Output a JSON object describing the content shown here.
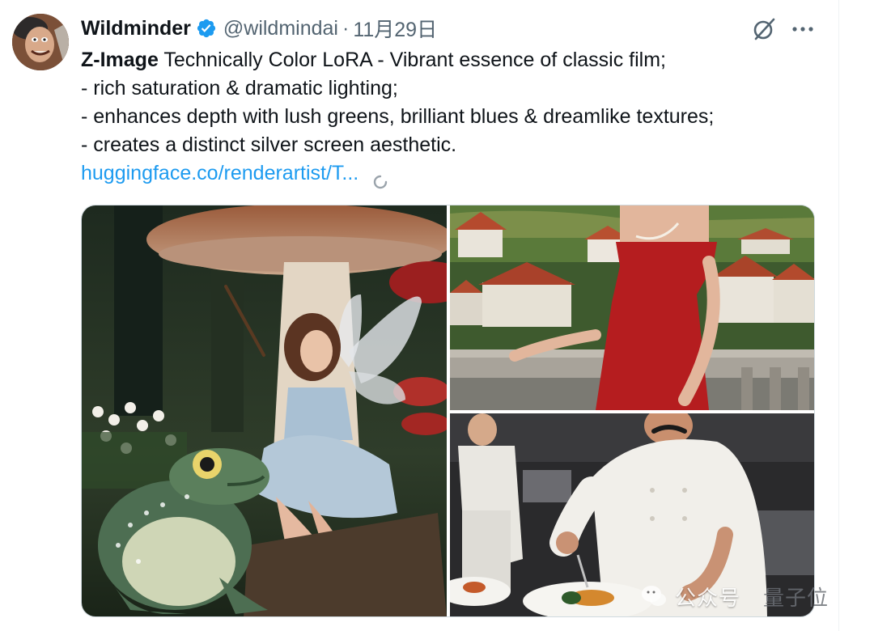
{
  "tweet": {
    "author": {
      "display_name": "Wildminder",
      "handle": "@wildmindai",
      "verified": true,
      "avatar": "avatar-portrait"
    },
    "separator": "·",
    "timestamp": "11月29日",
    "text": {
      "title_bold": "Z-Image",
      "title_rest": " Technically Color LoRA - Vibrant essence of classic film;",
      "lines": [
        "- rich saturation & dramatic lighting;",
        "- enhances depth with lush greens, brilliant blues & dreamlike textures;",
        "- creates a distinct silver screen aesthetic."
      ],
      "link": "huggingface.co/renderartist/T..."
    },
    "icons": {
      "verified": "verified-badge-icon",
      "grok": "grok-icon",
      "more": "more-options-icon",
      "loading": "loading-spinner-icon"
    },
    "media": [
      {
        "name": "fairy-on-mushroom-with-frog-image"
      },
      {
        "name": "woman-in-red-dress-on-balcony-image"
      },
      {
        "name": "chef-plating-dish-image"
      }
    ],
    "colors": {
      "link": "#1d9bf0",
      "verified": "#1d9bf0",
      "secondary_text": "#536471",
      "primary_text": "#0f1419"
    }
  },
  "watermark": {
    "text": "公众号",
    "brand": "量子位"
  }
}
